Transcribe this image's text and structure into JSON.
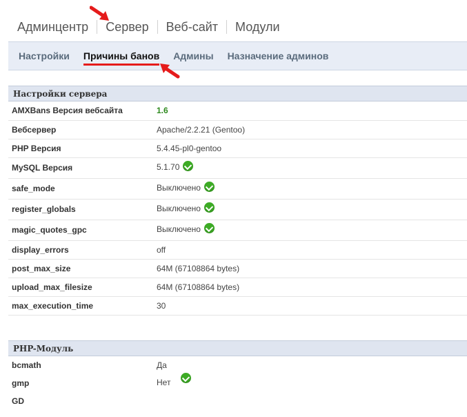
{
  "top_nav": [
    "Админцентр",
    "Сервер",
    "Веб-сайт",
    "Модули"
  ],
  "sub_nav": [
    "Настройки",
    "Причины банов",
    "Админы",
    "Назначение админов"
  ],
  "server_section": {
    "title": "Настройки сервера",
    "rows": [
      {
        "key": "AMXBans Версия вебсайта",
        "value": "1.6"
      },
      {
        "key": "Вебсервер",
        "value": "Apache/2.2.21 (Gentoo)"
      },
      {
        "key": "PHP Версия",
        "value": "5.4.45-pl0-gentoo"
      },
      {
        "key": "MySQL Версия",
        "value": "5.1.70"
      },
      {
        "key": "safe_mode",
        "value": "Выключено"
      },
      {
        "key": "register_globals",
        "value": "Выключено"
      },
      {
        "key": "magic_quotes_gpc",
        "value": "Выключено"
      },
      {
        "key": "display_errors",
        "value": "off"
      },
      {
        "key": "post_max_size",
        "value": "64M (67108864 bytes)"
      },
      {
        "key": "upload_max_filesize",
        "value": "64M (67108864 bytes)"
      },
      {
        "key": "max_execution_time",
        "value": "30"
      }
    ]
  },
  "php_section": {
    "title": "PHP-Модуль",
    "rows": [
      {
        "key": "bcmath",
        "value": "Да"
      },
      {
        "key": "gmp",
        "value": "Нет"
      },
      {
        "key": "GD",
        "value": ""
      }
    ]
  },
  "colors": {
    "accent_underline": "#e51b1b",
    "status_ok": "#3dab25",
    "version_green": "#2f8a1f"
  },
  "icons": {
    "status_ok": "check-circle-icon",
    "annotation": "red-arrow-icon"
  }
}
